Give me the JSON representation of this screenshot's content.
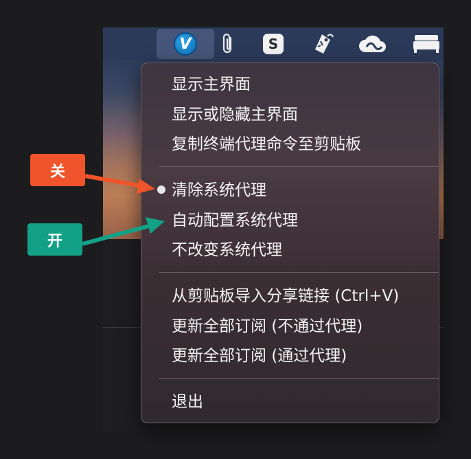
{
  "menu_bar": {
    "icons": [
      "v2ray-icon",
      "paperclip-icon",
      "skype-icon",
      "tag-icon",
      "creative-cloud-icon",
      "bed-icon"
    ],
    "v_logo_text": "V",
    "skype_letter": "S"
  },
  "menu": {
    "group1": [
      "显示主界面",
      "显示或隐藏主界面",
      "复制终端代理命令至剪贴板"
    ],
    "group2": [
      "清除系统代理",
      "自动配置系统代理",
      "不改变系统代理"
    ],
    "group3": [
      "从剪贴板导入分享链接 (Ctrl+V)",
      "更新全部订阅 (不通过代理)",
      "更新全部订阅 (通过代理)"
    ],
    "group4": [
      "退出"
    ],
    "selected_item": "清除系统代理"
  },
  "annotations": {
    "off_label": "关",
    "on_label": "开",
    "off_color": "#f0542a",
    "on_color": "#12a086"
  }
}
